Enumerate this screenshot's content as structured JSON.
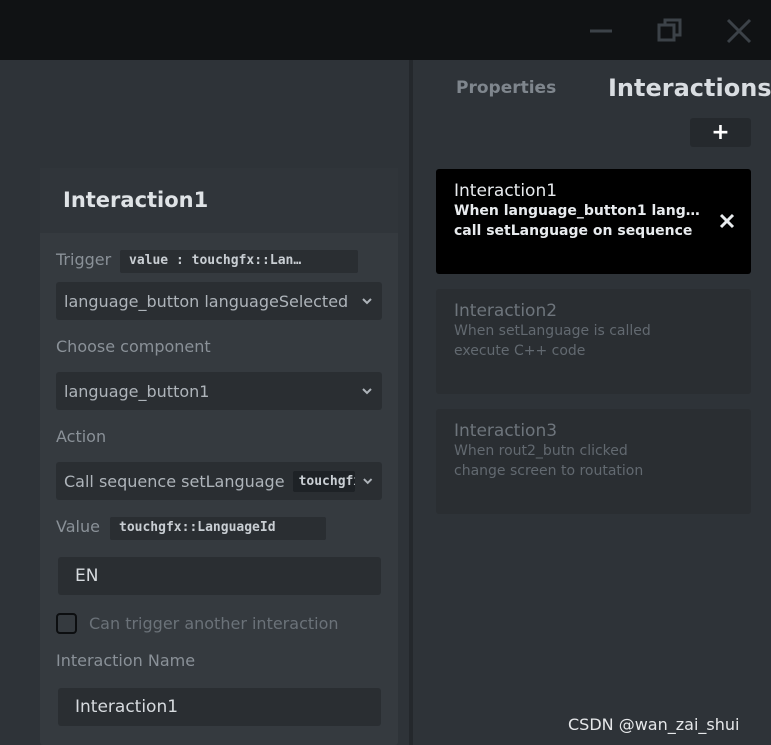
{
  "window": {
    "minimize_icon": "minimize-icon",
    "maximize_icon": "restore-icon",
    "close_icon": "close-icon"
  },
  "tabs": {
    "properties": "Properties",
    "interactions": "Interactions",
    "add_label": "+"
  },
  "interaction_list": [
    {
      "title": "Interaction1",
      "line1": "When language_button1 languag…",
      "line2": "call setLanguage on sequence"
    },
    {
      "title": "Interaction2",
      "line1": "When setLanguage is called",
      "line2": "execute C++ code"
    },
    {
      "title": "Interaction3",
      "line1": "When rout2_butn clicked",
      "line2": "change screen to routation"
    }
  ],
  "editor": {
    "title": "Interaction1",
    "trigger_label": "Trigger",
    "trigger_type": "value : touchgfx::Lan…",
    "trigger_value": "language_button languageSelected",
    "choose_component_label": "Choose component",
    "component_value": "language_button1",
    "action_label": "Action",
    "action_value": "Call sequence setLanguage",
    "action_type": "touchgfx",
    "value_label": "Value",
    "value_type": "touchgfx::LanguageId",
    "value_input": "EN",
    "can_trigger_label": "Can trigger another interaction",
    "interaction_name_label": "Interaction Name",
    "interaction_name_value": "Interaction1"
  },
  "watermark": "CSDN @wan_zai_shui",
  "colors": {
    "titlebar": "#101214",
    "background": "#2e3338",
    "active_card": "#000000",
    "card": "#2a2e32"
  }
}
